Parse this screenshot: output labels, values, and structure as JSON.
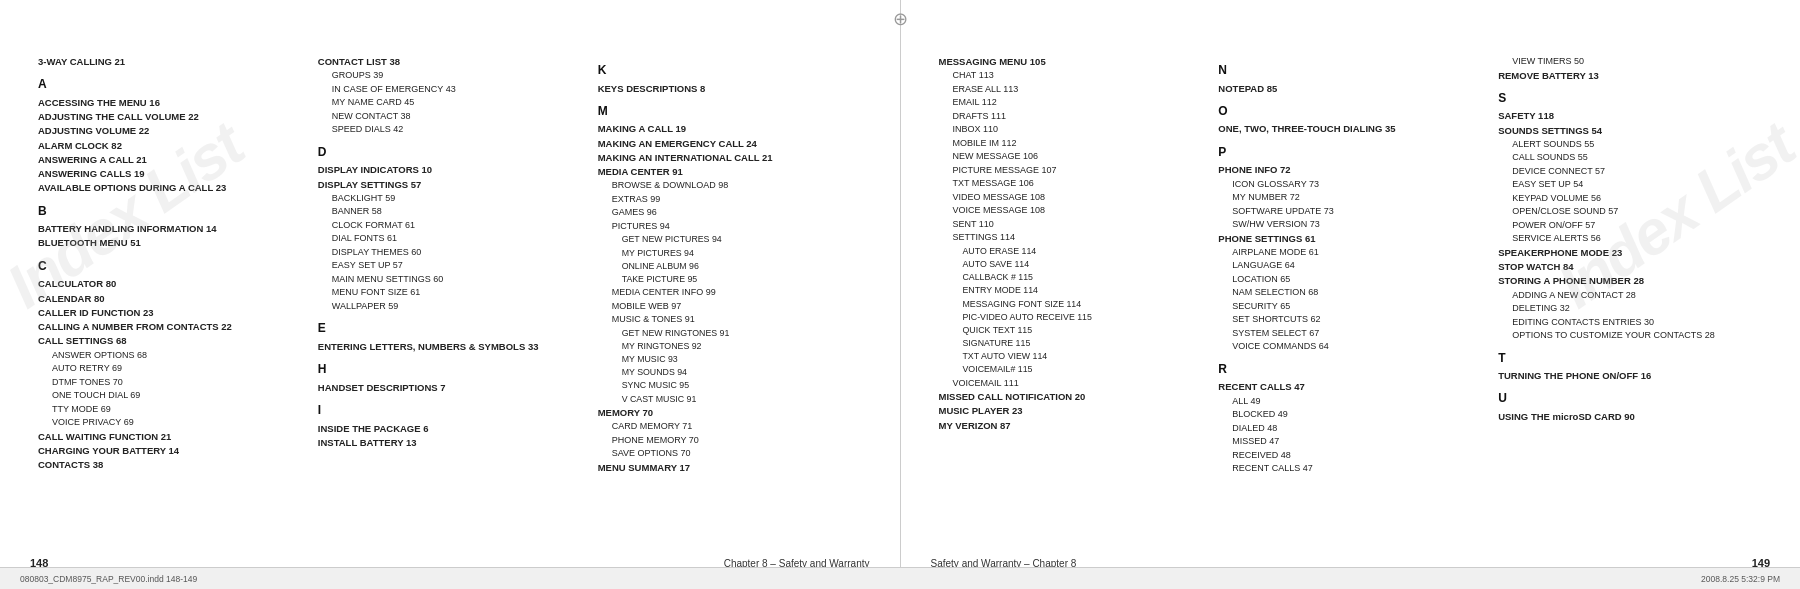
{
  "meta": {
    "file": "080803_CDM8975_RAP_REV00.indd  148-149",
    "date": "2008.8.25  5:32:9 PM",
    "compass_symbol": "⊕"
  },
  "watermark": "Index List",
  "left_page": {
    "page_number": "148",
    "footer_chapter": "Chapter 8 – Safety and Warranty",
    "columns": [
      {
        "id": "col1",
        "entries": [
          {
            "type": "top",
            "text": "3-WAY CALLING",
            "page": "21"
          },
          {
            "type": "letter",
            "text": "A"
          },
          {
            "type": "sub",
            "text": "ACCESSING THE MENU",
            "page": "16"
          },
          {
            "type": "sub",
            "text": "ADJUSTING THE CALL VOLUME",
            "page": "22"
          },
          {
            "type": "sub",
            "text": "ADJUSTING VOLUME",
            "page": "22"
          },
          {
            "type": "sub",
            "text": "ALARM CLOCK",
            "page": "82"
          },
          {
            "type": "sub",
            "text": "ANSWERING A CALL",
            "page": "21"
          },
          {
            "type": "sub",
            "text": "ANSWERING CALLS",
            "page": "19"
          },
          {
            "type": "sub",
            "text": "AVAILABLE OPTIONS DURING A CALL",
            "page": "23"
          },
          {
            "type": "letter",
            "text": "B"
          },
          {
            "type": "sub",
            "text": "BATTERY HANDLING INFORMATION",
            "page": "14"
          },
          {
            "type": "sub",
            "text": "BLUETOOTH MENU",
            "page": "51"
          },
          {
            "type": "letter",
            "text": "C"
          },
          {
            "type": "sub",
            "text": "CALCULATOR",
            "page": "80"
          },
          {
            "type": "sub",
            "text": "CALENDAR",
            "page": "80"
          },
          {
            "type": "sub",
            "text": "CALLER ID FUNCTION",
            "page": "23"
          },
          {
            "type": "sub",
            "text": "CALLING A NUMBER FROM CONTACTS",
            "page": "22"
          },
          {
            "type": "sub",
            "text": "CALL SETTINGS",
            "page": "68"
          },
          {
            "type": "sub2",
            "text": "ANSWER OPTIONS",
            "page": "68"
          },
          {
            "type": "sub2",
            "text": "AUTO RETRY",
            "page": "69"
          },
          {
            "type": "sub2",
            "text": "DTMF TONES",
            "page": "70"
          },
          {
            "type": "sub2",
            "text": "ONE TOUCH DIAL",
            "page": "69"
          },
          {
            "type": "sub2",
            "text": "TTY MODE",
            "page": "69"
          },
          {
            "type": "sub2",
            "text": "VOICE PRIVACY",
            "page": "69"
          },
          {
            "type": "sub",
            "text": "CALL WAITING FUNCTION",
            "page": "21"
          },
          {
            "type": "sub",
            "text": "CHARGING YOUR BATTERY",
            "page": "14"
          },
          {
            "type": "sub",
            "text": "CONTACTS",
            "page": "38"
          }
        ]
      },
      {
        "id": "col2",
        "entries": [
          {
            "type": "sub",
            "text": "CONTACT LIST",
            "page": "38"
          },
          {
            "type": "sub2",
            "text": "GROUPS",
            "page": "39"
          },
          {
            "type": "sub2",
            "text": "IN CASE OF EMERGENCY",
            "page": "43"
          },
          {
            "type": "sub2",
            "text": "MY NAME CARD",
            "page": "45"
          },
          {
            "type": "sub2",
            "text": "NEW CONTACT",
            "page": "38"
          },
          {
            "type": "sub2",
            "text": "SPEED DIALS",
            "page": "42"
          },
          {
            "type": "letter",
            "text": "D"
          },
          {
            "type": "sub",
            "text": "DISPLAY INDICATORS",
            "page": "10"
          },
          {
            "type": "sub",
            "text": "DISPLAY SETTINGS",
            "page": "57"
          },
          {
            "type": "sub2",
            "text": "BACKLIGHT",
            "page": "59"
          },
          {
            "type": "sub2",
            "text": "BANNER",
            "page": "58"
          },
          {
            "type": "sub2",
            "text": "CLOCK FORMAT",
            "page": "61"
          },
          {
            "type": "sub2",
            "text": "DIAL FONTS",
            "page": "61"
          },
          {
            "type": "sub2",
            "text": "DISPLAY THEMES",
            "page": "60"
          },
          {
            "type": "sub2",
            "text": "EASY SET UP",
            "page": "57"
          },
          {
            "type": "sub2",
            "text": "MAIN MENU SETTINGS",
            "page": "60"
          },
          {
            "type": "sub2",
            "text": "MENU FONT SIZE",
            "page": "61"
          },
          {
            "type": "sub2",
            "text": "WALLPAPER",
            "page": "59"
          },
          {
            "type": "letter",
            "text": "E"
          },
          {
            "type": "sub",
            "text": "ENTERING LETTERS, NUMBERS & SYMBOLS",
            "page": "33"
          },
          {
            "type": "letter",
            "text": "H"
          },
          {
            "type": "sub",
            "text": "HANDSET DESCRIPTIONS",
            "page": "7"
          },
          {
            "type": "letter",
            "text": "I"
          },
          {
            "type": "sub",
            "text": "INSIDE THE PACKAGE",
            "page": "6"
          },
          {
            "type": "sub",
            "text": "INSTALL BATTERY",
            "page": "13"
          }
        ]
      },
      {
        "id": "col3",
        "entries": [
          {
            "type": "letter",
            "text": "K"
          },
          {
            "type": "sub",
            "text": "KEYS DESCRIPTIONS",
            "page": "8"
          },
          {
            "type": "letter",
            "text": "M"
          },
          {
            "type": "sub",
            "text": "MAKING A CALL",
            "page": "19"
          },
          {
            "type": "sub",
            "text": "MAKING AN EMERGENCY CALL",
            "page": "24"
          },
          {
            "type": "sub",
            "text": "MAKING AN INTERNATIONAL CALL",
            "page": "21"
          },
          {
            "type": "sub",
            "text": "MEDIA CENTER",
            "page": "91"
          },
          {
            "type": "sub2",
            "text": "BROWSE & DOWNLOAD",
            "page": "98"
          },
          {
            "type": "sub2",
            "text": "EXTRAS",
            "page": "99"
          },
          {
            "type": "sub2",
            "text": "GAMES",
            "page": "96"
          },
          {
            "type": "sub2",
            "text": "PICTURES",
            "page": "94"
          },
          {
            "type": "sub3",
            "text": "GET NEW PICTURES",
            "page": "94"
          },
          {
            "type": "sub3",
            "text": "MY PICTURES",
            "page": "94"
          },
          {
            "type": "sub3",
            "text": "ONLINE ALBUM",
            "page": "96"
          },
          {
            "type": "sub3",
            "text": "TAKE PICTURE",
            "page": "95"
          },
          {
            "type": "sub2",
            "text": "MEDIA CENTER INFO",
            "page": "99"
          },
          {
            "type": "sub2",
            "text": "MOBILE WEB",
            "page": "97"
          },
          {
            "type": "sub2",
            "text": "MUSIC & TONES",
            "page": "91"
          },
          {
            "type": "sub3",
            "text": "GET NEW RINGTONES",
            "page": "91"
          },
          {
            "type": "sub3",
            "text": "MY RINGTONES",
            "page": "92"
          },
          {
            "type": "sub3",
            "text": "MY MUSIC",
            "page": "93"
          },
          {
            "type": "sub3",
            "text": "MY SOUNDS",
            "page": "94"
          },
          {
            "type": "sub3",
            "text": "SYNC MUSIC",
            "page": "95"
          },
          {
            "type": "sub3",
            "text": "V CAST MUSIC",
            "page": "91"
          },
          {
            "type": "sub",
            "text": "MEMORY",
            "page": "70"
          },
          {
            "type": "sub2",
            "text": "CARD MEMORY",
            "page": "71"
          },
          {
            "type": "sub2",
            "text": "PHONE MEMORY",
            "page": "70"
          },
          {
            "type": "sub2",
            "text": "SAVE OPTIONS",
            "page": "70"
          },
          {
            "type": "sub",
            "text": "MENU SUMMARY",
            "page": "17"
          }
        ]
      }
    ]
  },
  "right_page": {
    "page_number": "149",
    "footer_chapter": "Safety and Warranty – Chapter 8",
    "columns": [
      {
        "id": "col4",
        "entries": [
          {
            "type": "sub",
            "text": "MESSAGING MENU",
            "page": "105"
          },
          {
            "type": "sub2",
            "text": "CHAT",
            "page": "113"
          },
          {
            "type": "sub2",
            "text": "ERASE ALL",
            "page": "113"
          },
          {
            "type": "sub2",
            "text": "EMAIL",
            "page": "112"
          },
          {
            "type": "sub2",
            "text": "DRAFTS",
            "page": "111"
          },
          {
            "type": "sub2",
            "text": "INBOX",
            "page": "110"
          },
          {
            "type": "sub2",
            "text": "MOBILE IM",
            "page": "112"
          },
          {
            "type": "sub2",
            "text": "NEW MESSAGE",
            "page": "106"
          },
          {
            "type": "sub2",
            "text": "PICTURE MESSAGE",
            "page": "107"
          },
          {
            "type": "sub2",
            "text": "TXT MESSAGE",
            "page": "106"
          },
          {
            "type": "sub2",
            "text": "VIDEO MESSAGE",
            "page": "108"
          },
          {
            "type": "sub2",
            "text": "VOICE MESSAGE",
            "page": "108"
          },
          {
            "type": "sub2",
            "text": "SENT",
            "page": "110"
          },
          {
            "type": "sub2",
            "text": "SETTINGS",
            "page": "114"
          },
          {
            "type": "sub3",
            "text": "AUTO ERASE",
            "page": "114"
          },
          {
            "type": "sub3",
            "text": "AUTO SAVE",
            "page": "114"
          },
          {
            "type": "sub3",
            "text": "CALLBACK #",
            "page": "115"
          },
          {
            "type": "sub3",
            "text": "ENTRY MODE",
            "page": "114"
          },
          {
            "type": "sub3",
            "text": "MESSAGING FONT SIZE",
            "page": "114"
          },
          {
            "type": "sub3",
            "text": "PIC-VIDEO AUTO RECEIVE",
            "page": "115"
          },
          {
            "type": "sub3",
            "text": "QUICK TEXT",
            "page": "115"
          },
          {
            "type": "sub3",
            "text": "SIGNATURE",
            "page": "115"
          },
          {
            "type": "sub3",
            "text": "TXT AUTO VIEW",
            "page": "114"
          },
          {
            "type": "sub3",
            "text": "VOICEMAIL#",
            "page": "115"
          },
          {
            "type": "sub2",
            "text": "VOICEMAIL",
            "page": "111"
          },
          {
            "type": "sub",
            "text": "MISSED CALL NOTIFICATION",
            "page": "20"
          },
          {
            "type": "sub",
            "text": "MUSIC PLAYER",
            "page": "23"
          },
          {
            "type": "sub",
            "text": "MY VERIZON",
            "page": "87"
          }
        ]
      },
      {
        "id": "col5",
        "entries": [
          {
            "type": "letter",
            "text": "N"
          },
          {
            "type": "sub",
            "text": "NOTEPAD",
            "page": "85"
          },
          {
            "type": "letter",
            "text": "O"
          },
          {
            "type": "sub",
            "text": "ONE, TWO, THREE-TOUCH DIALING",
            "page": "35"
          },
          {
            "type": "letter",
            "text": "P"
          },
          {
            "type": "sub",
            "text": "PHONE INFO",
            "page": "72"
          },
          {
            "type": "sub2",
            "text": "ICON GLOSSARY",
            "page": "73"
          },
          {
            "type": "sub2",
            "text": "MY NUMBER",
            "page": "72"
          },
          {
            "type": "sub2",
            "text": "SOFTWARE UPDATE",
            "page": "73"
          },
          {
            "type": "sub2",
            "text": "SW/HW VERSION",
            "page": "73"
          },
          {
            "type": "sub",
            "text": "PHONE SETTINGS",
            "page": "61"
          },
          {
            "type": "sub2",
            "text": "AIRPLANE MODE",
            "page": "61"
          },
          {
            "type": "sub2",
            "text": "LANGUAGE",
            "page": "64"
          },
          {
            "type": "sub2",
            "text": "LOCATION",
            "page": "65"
          },
          {
            "type": "sub2",
            "text": "NAM SELECTION",
            "page": "68"
          },
          {
            "type": "sub2",
            "text": "SECURITY",
            "page": "65"
          },
          {
            "type": "sub2",
            "text": "SET SHORTCUTS",
            "page": "62"
          },
          {
            "type": "sub2",
            "text": "SYSTEM SELECT",
            "page": "67"
          },
          {
            "type": "sub2",
            "text": "VOICE COMMANDS",
            "page": "64"
          },
          {
            "type": "letter",
            "text": "R"
          },
          {
            "type": "sub",
            "text": "RECENT CALLS",
            "page": "47"
          },
          {
            "type": "sub2",
            "text": "ALL",
            "page": "49"
          },
          {
            "type": "sub2",
            "text": "BLOCKED",
            "page": "49"
          },
          {
            "type": "sub2",
            "text": "DIALED",
            "page": "48"
          },
          {
            "type": "sub2",
            "text": "MISSED",
            "page": "47"
          },
          {
            "type": "sub2",
            "text": "RECEIVED",
            "page": "48"
          },
          {
            "type": "sub2",
            "text": "RECENT CALLS",
            "page": "47"
          }
        ]
      },
      {
        "id": "col6",
        "entries": [
          {
            "type": "sub2",
            "text": "VIEW TIMERS",
            "page": "50"
          },
          {
            "type": "sub",
            "text": "REMOVE BATTERY",
            "page": "13"
          },
          {
            "type": "letter",
            "text": "S"
          },
          {
            "type": "sub",
            "text": "SAFETY",
            "page": "118"
          },
          {
            "type": "sub",
            "text": "SOUNDS SETTINGS",
            "page": "54"
          },
          {
            "type": "sub2",
            "text": "ALERT SOUNDS",
            "page": "55"
          },
          {
            "type": "sub2",
            "text": "CALL SOUNDS",
            "page": "55"
          },
          {
            "type": "sub2",
            "text": "DEVICE CONNECT",
            "page": "57"
          },
          {
            "type": "sub2",
            "text": "EASY SET UP",
            "page": "54"
          },
          {
            "type": "sub2",
            "text": "KEYPAD VOLUME",
            "page": "56"
          },
          {
            "type": "sub2",
            "text": "OPEN/CLOSE SOUND",
            "page": "57"
          },
          {
            "type": "sub2",
            "text": "POWER ON/OFF",
            "page": "57"
          },
          {
            "type": "sub2",
            "text": "SERVICE ALERTS",
            "page": "56"
          },
          {
            "type": "sub",
            "text": "SPEAKERPHONE MODE",
            "page": "23"
          },
          {
            "type": "sub",
            "text": "STOP WATCH",
            "page": "84"
          },
          {
            "type": "sub",
            "text": "STORING A PHONE NUMBER",
            "page": "28"
          },
          {
            "type": "sub2",
            "text": "ADDING A NEW CONTACT",
            "page": "28"
          },
          {
            "type": "sub2",
            "text": "DELETING",
            "page": "32"
          },
          {
            "type": "sub2",
            "text": "EDITING CONTACTS ENTRIES",
            "page": "30"
          },
          {
            "type": "sub2",
            "text": "OPTIONS TO CUSTOMIZE YOUR CONTACTS",
            "page": "28"
          },
          {
            "type": "letter",
            "text": "T"
          },
          {
            "type": "sub",
            "text": "TURNING THE PHONE ON/OFF",
            "page": "16"
          },
          {
            "type": "letter",
            "text": "U"
          },
          {
            "type": "sub",
            "text": "USING THE microSD CARD",
            "page": "90"
          }
        ]
      }
    ]
  }
}
